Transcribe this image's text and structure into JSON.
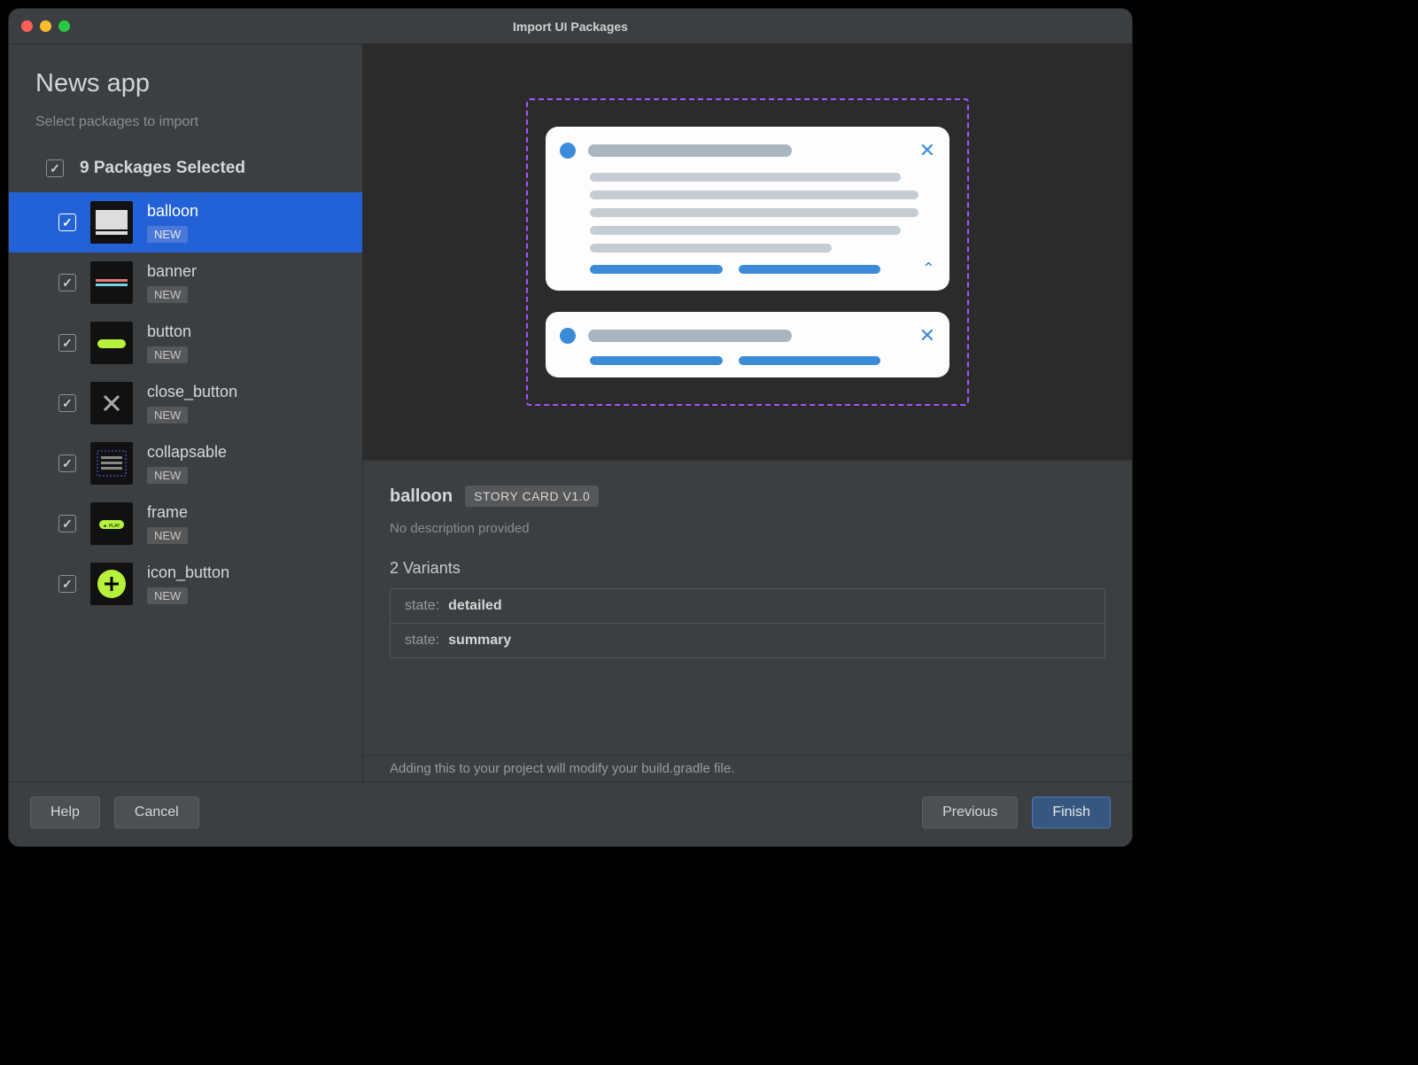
{
  "window": {
    "title": "Import UI Packages"
  },
  "sidebar": {
    "app_title": "News app",
    "subtitle": "Select packages to import",
    "select_all_label": "9 Packages Selected",
    "packages": [
      {
        "name": "balloon",
        "badge": "NEW",
        "selected": true
      },
      {
        "name": "banner",
        "badge": "NEW",
        "selected": false
      },
      {
        "name": "button",
        "badge": "NEW",
        "selected": false
      },
      {
        "name": "close_button",
        "badge": "NEW",
        "selected": false
      },
      {
        "name": "collapsable",
        "badge": "NEW",
        "selected": false
      },
      {
        "name": "frame",
        "badge": "NEW",
        "selected": false
      },
      {
        "name": "icon_button",
        "badge": "NEW",
        "selected": false
      }
    ]
  },
  "details": {
    "name": "balloon",
    "tag": "STORY CARD V1.0",
    "description": "No description provided",
    "variants_heading": "2 Variants",
    "variants": [
      {
        "key": "state:",
        "value": "detailed"
      },
      {
        "key": "state:",
        "value": "summary"
      }
    ]
  },
  "note": "Adding this to your project will modify your build.gradle file.",
  "footer": {
    "help": "Help",
    "cancel": "Cancel",
    "previous": "Previous",
    "finish": "Finish"
  }
}
